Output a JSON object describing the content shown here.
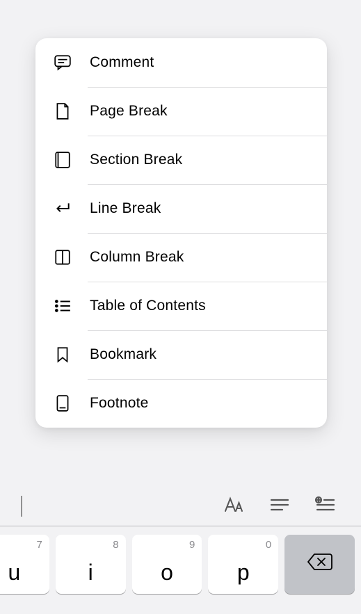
{
  "menu": [
    {
      "label": "Comment",
      "icon": "comment-icon"
    },
    {
      "label": "Page Break",
      "icon": "page-break-icon"
    },
    {
      "label": "Section Break",
      "icon": "section-break-icon"
    },
    {
      "label": "Line Break",
      "icon": "line-break-icon"
    },
    {
      "label": "Column Break",
      "icon": "column-break-icon"
    },
    {
      "label": "Table of Contents",
      "icon": "toc-icon"
    },
    {
      "label": "Bookmark",
      "icon": "bookmark-icon"
    },
    {
      "label": "Footnote",
      "icon": "footnote-icon"
    }
  ],
  "shortcut_bar": [
    {
      "name": "text-style-button",
      "icon": "text-style-icon"
    },
    {
      "name": "paragraph-button",
      "icon": "paragraph-icon"
    },
    {
      "name": "insert-button",
      "icon": "insert-list-icon"
    }
  ],
  "keyboard": {
    "keys": [
      {
        "name": "key-u",
        "main": "u",
        "digit": "7"
      },
      {
        "name": "key-i",
        "main": "i",
        "digit": "8"
      },
      {
        "name": "key-o",
        "main": "o",
        "digit": "9"
      },
      {
        "name": "key-p",
        "main": "p",
        "digit": "0"
      },
      {
        "name": "key-backspace",
        "main": "",
        "digit": "",
        "kind": "backspace"
      }
    ]
  }
}
